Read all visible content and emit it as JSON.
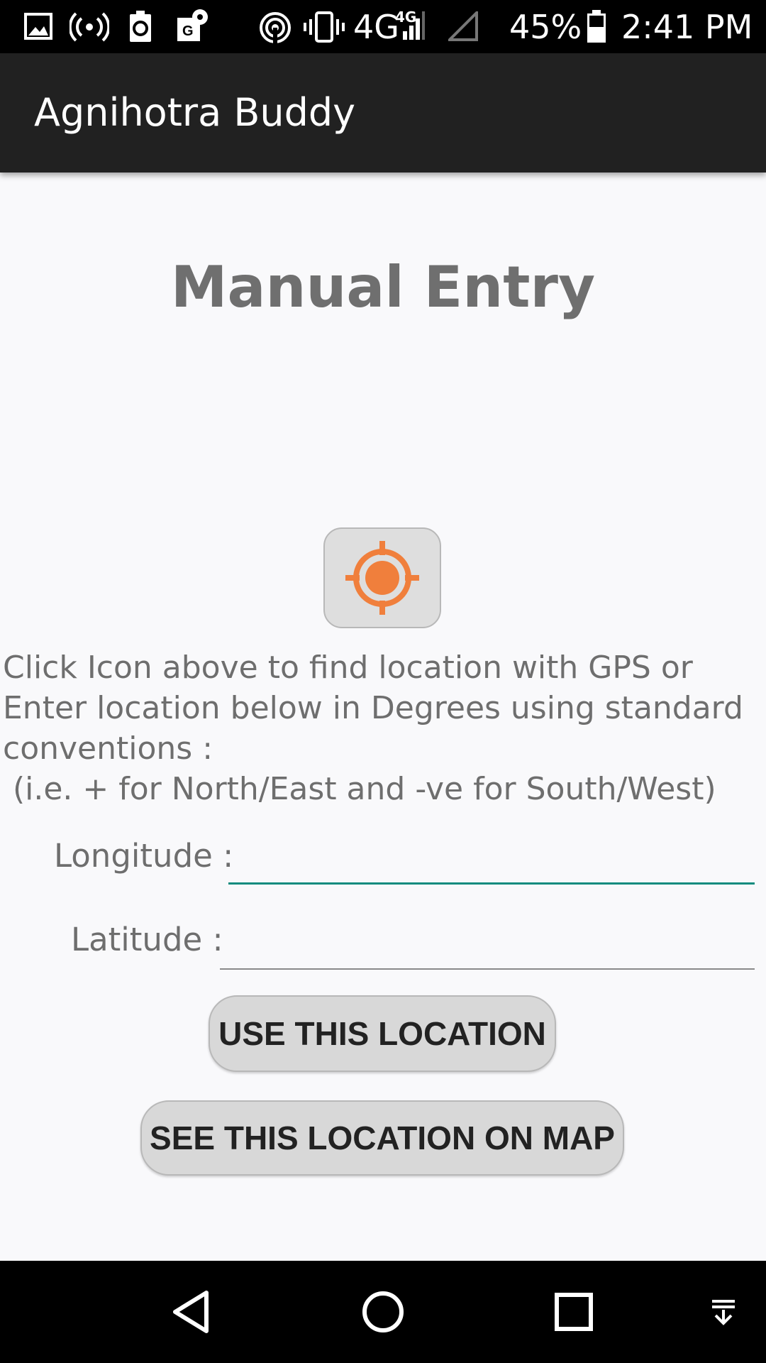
{
  "status_bar": {
    "battery_percent": "45%",
    "time": "2:41 PM",
    "network": "4G",
    "network_small": "4G",
    "icons": [
      "gallery-icon",
      "hotspot-icon",
      "battery-saver-icon",
      "maps-icon",
      "cast-icon",
      "vibrate-icon",
      "signal-icon",
      "no-signal-icon",
      "battery-icon"
    ]
  },
  "app_bar": {
    "title": "Agnihotra Buddy"
  },
  "main": {
    "title": "Manual Entry",
    "gps_button_icon": "gps-target-icon",
    "instructions": [
      "Click Icon above to find location with GPS or",
      "Enter location below in Degrees using standard",
      "conventions :",
      " (i.e. + for North/East and -ve for South/West)"
    ],
    "longitude": {
      "label": "Longitude :",
      "value": "",
      "placeholder": ""
    },
    "latitude": {
      "label": "Latitude :",
      "value": "",
      "placeholder": ""
    },
    "use_location_button": "USE THIS LOCATION",
    "see_on_map_button": "SEE THIS LOCATION ON MAP"
  },
  "nav_bar": {
    "icons": [
      "back-icon",
      "home-icon",
      "recents-icon",
      "notifications-down-icon"
    ]
  },
  "colors": {
    "accent": "#128c7e",
    "gps_orange": "#f07f3c",
    "app_bar": "#212121"
  }
}
